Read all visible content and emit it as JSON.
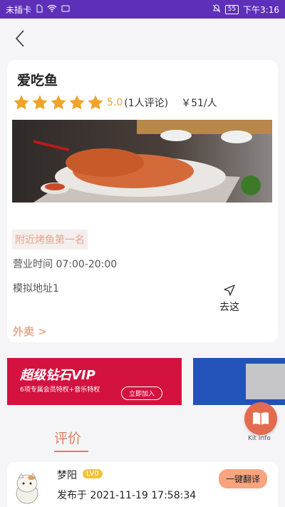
{
  "status_bar": {
    "carrier": "未插卡",
    "battery": "55",
    "time": "下午3:16"
  },
  "restaurant": {
    "name": "爱吃鱼",
    "rating_score": "5.0",
    "star_count": 5,
    "review_count": "(1人评论)",
    "price": "￥51/人",
    "tag": "附近烤鱼第一名",
    "hours": "营业时间 07:00-20:00",
    "address": "模拟地址1",
    "go_label": "去这",
    "takeout_link": "外卖 >"
  },
  "banner": {
    "title": "超级钻石VIP",
    "subtitle": "6项专属会员特权+音乐特权",
    "button": "立即加入"
  },
  "kit": {
    "label": "Kit Info"
  },
  "reviews": {
    "section_title": "评价",
    "items": [
      {
        "name": "梦阳",
        "level": "LV0",
        "published": "发布于 2021-11-19 17:58:34",
        "translate_label": "一键翻译"
      }
    ]
  },
  "colors": {
    "status_bar": "#5e2fb8",
    "star": "#f0a42a",
    "accent": "#e07d5c",
    "tag_text": "#e5a58d",
    "translate_button": "#f8a47f",
    "level_badge": "#f2c23a"
  }
}
